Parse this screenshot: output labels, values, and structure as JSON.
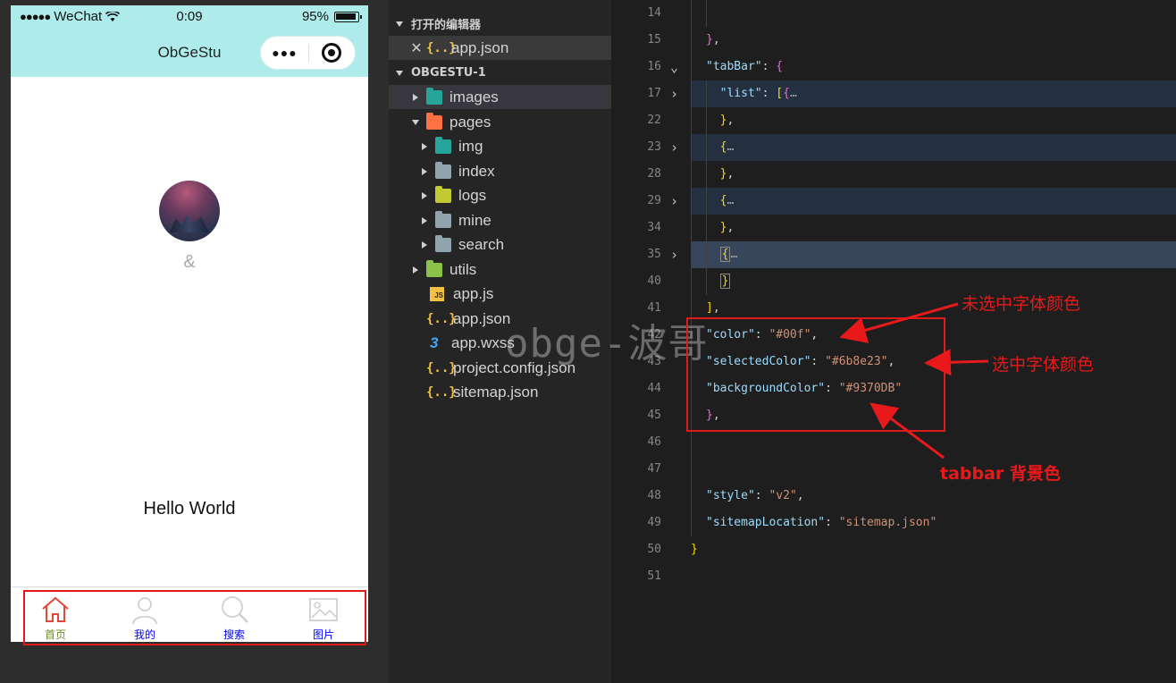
{
  "status_bar": {
    "carrier": "WeChat",
    "time": "0:09",
    "battery": "95%"
  },
  "nav": {
    "title": "ObGeStu"
  },
  "profile": {
    "nickname": "&",
    "motto": "Hello World"
  },
  "tabbar": {
    "items": [
      {
        "label": "首页",
        "icon": "home-icon"
      },
      {
        "label": "我的",
        "icon": "user-icon"
      },
      {
        "label": "搜索",
        "icon": "search-icon"
      },
      {
        "label": "图片",
        "icon": "image-icon"
      }
    ],
    "colors": {
      "color": "#0000ff",
      "selectedColor": "#6b8e23",
      "backgroundColor": "#ffffff"
    }
  },
  "explorer": {
    "open_editors_title": "打开的编辑器",
    "open_file": "app.json",
    "project_title": "OBGESTU-1",
    "tree": {
      "images": "images",
      "pages": "pages",
      "img": "img",
      "index": "index",
      "logs": "logs",
      "mine": "mine",
      "search": "search",
      "utils": "utils",
      "app_js": "app.js",
      "app_json": "app.json",
      "app_wxss": "app.wxss",
      "project_config": "project.config.json",
      "sitemap": "sitemap.json"
    }
  },
  "editor": {
    "line_numbers": [
      "14",
      "15",
      "16",
      "17",
      "22",
      "23",
      "28",
      "29",
      "34",
      "35",
      "40",
      "41",
      "42",
      "43",
      "44",
      "45",
      "46",
      "47",
      "48",
      "49",
      "50",
      "51"
    ],
    "tabBar_key": "\"tabBar\"",
    "list_key": "\"list\"",
    "color_key": "\"color\"",
    "color_val": "\"#00f\"",
    "selected_key": "\"selectedColor\"",
    "selected_val": "\"#6b8e23\"",
    "bg_key": "\"backgroundColor\"",
    "bg_val": "\"#9370DB\"",
    "style_key": "\"style\"",
    "style_val": "\"v2\"",
    "sitemap_key": "\"sitemapLocation\"",
    "sitemap_val": "\"sitemap.json\""
  },
  "annotations": {
    "unselected": "未选中字体颜色",
    "selected": "选中字体颜色",
    "background": "tabbar 背景色",
    "watermark": "obge-波哥"
  }
}
